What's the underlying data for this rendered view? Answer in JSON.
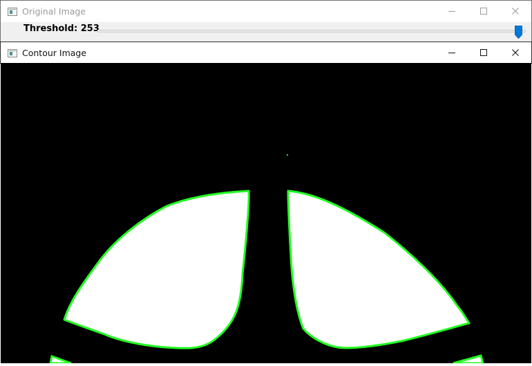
{
  "windows": {
    "original": {
      "title": "Original Image"
    },
    "contour": {
      "title": "Contour Image"
    }
  },
  "trackbar": {
    "label": "Threshold: 253",
    "value": 253,
    "max": 255,
    "thumb_color": "#0078d7"
  },
  "image": {
    "background_color": "#000000",
    "contour_color": "#00ff00",
    "fill_color": "#ffffff"
  }
}
